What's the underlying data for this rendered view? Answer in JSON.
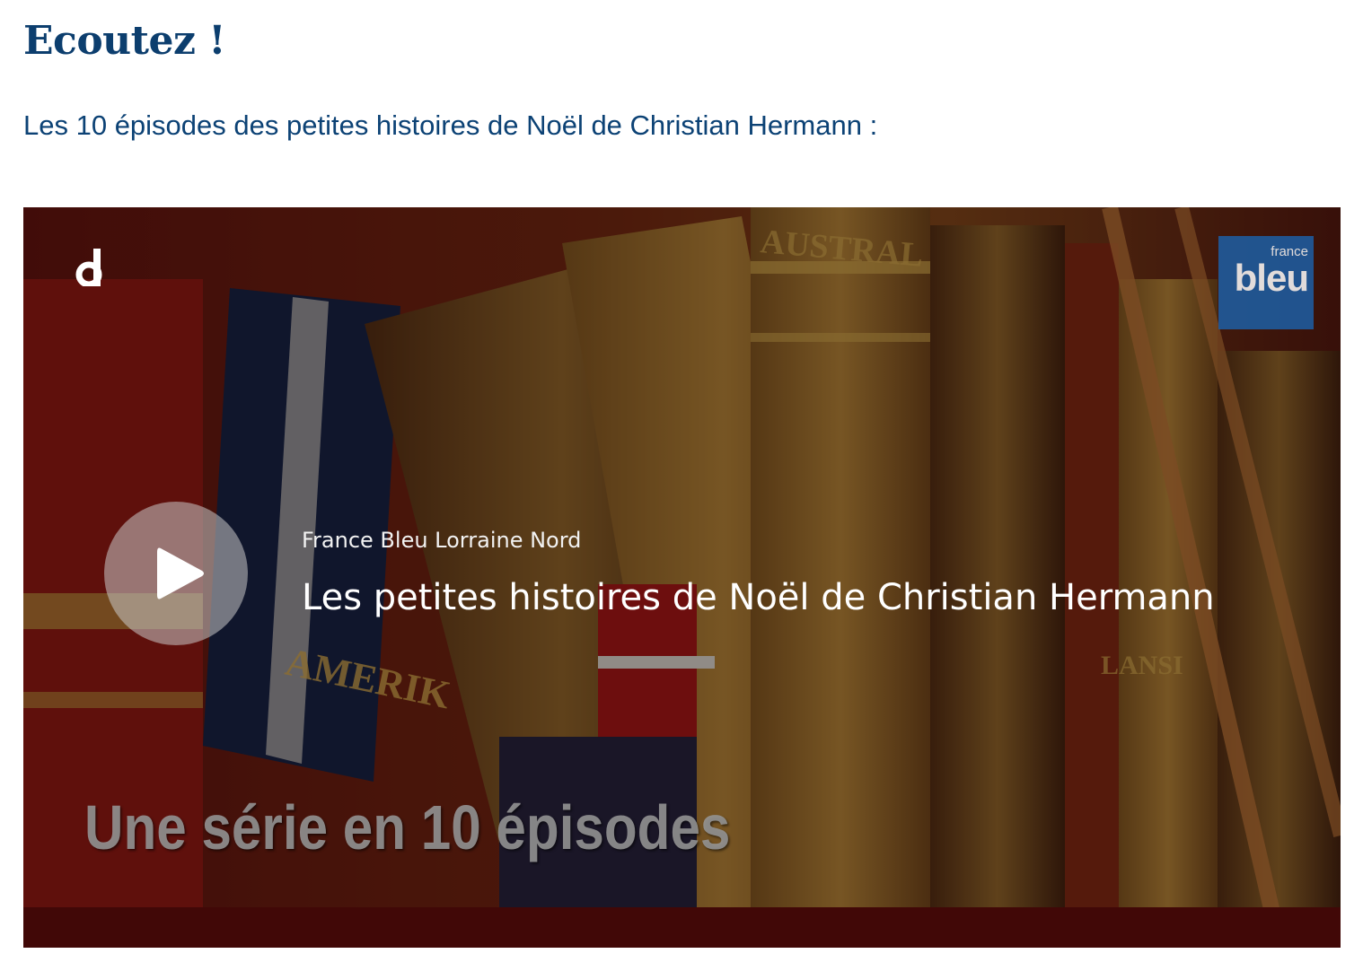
{
  "heading": "Ecoutez !",
  "intro": "Les 10 épisodes des petites histoires de Noël de Christian Hermann :",
  "video": {
    "channel": "France Bleu Lorraine Nord",
    "title": "Les petites histoires de Noël de Christian Hermann",
    "caption": "Une série en 10 épisodes",
    "player_logo_letter": "d",
    "broadcaster_logo_small": "france",
    "broadcaster_logo_big": "bleu",
    "play_icon": "play-icon"
  },
  "colors": {
    "heading": "#0c3e6e",
    "intro": "#0c4275",
    "broadcaster_blue": "#1d5fa6"
  }
}
